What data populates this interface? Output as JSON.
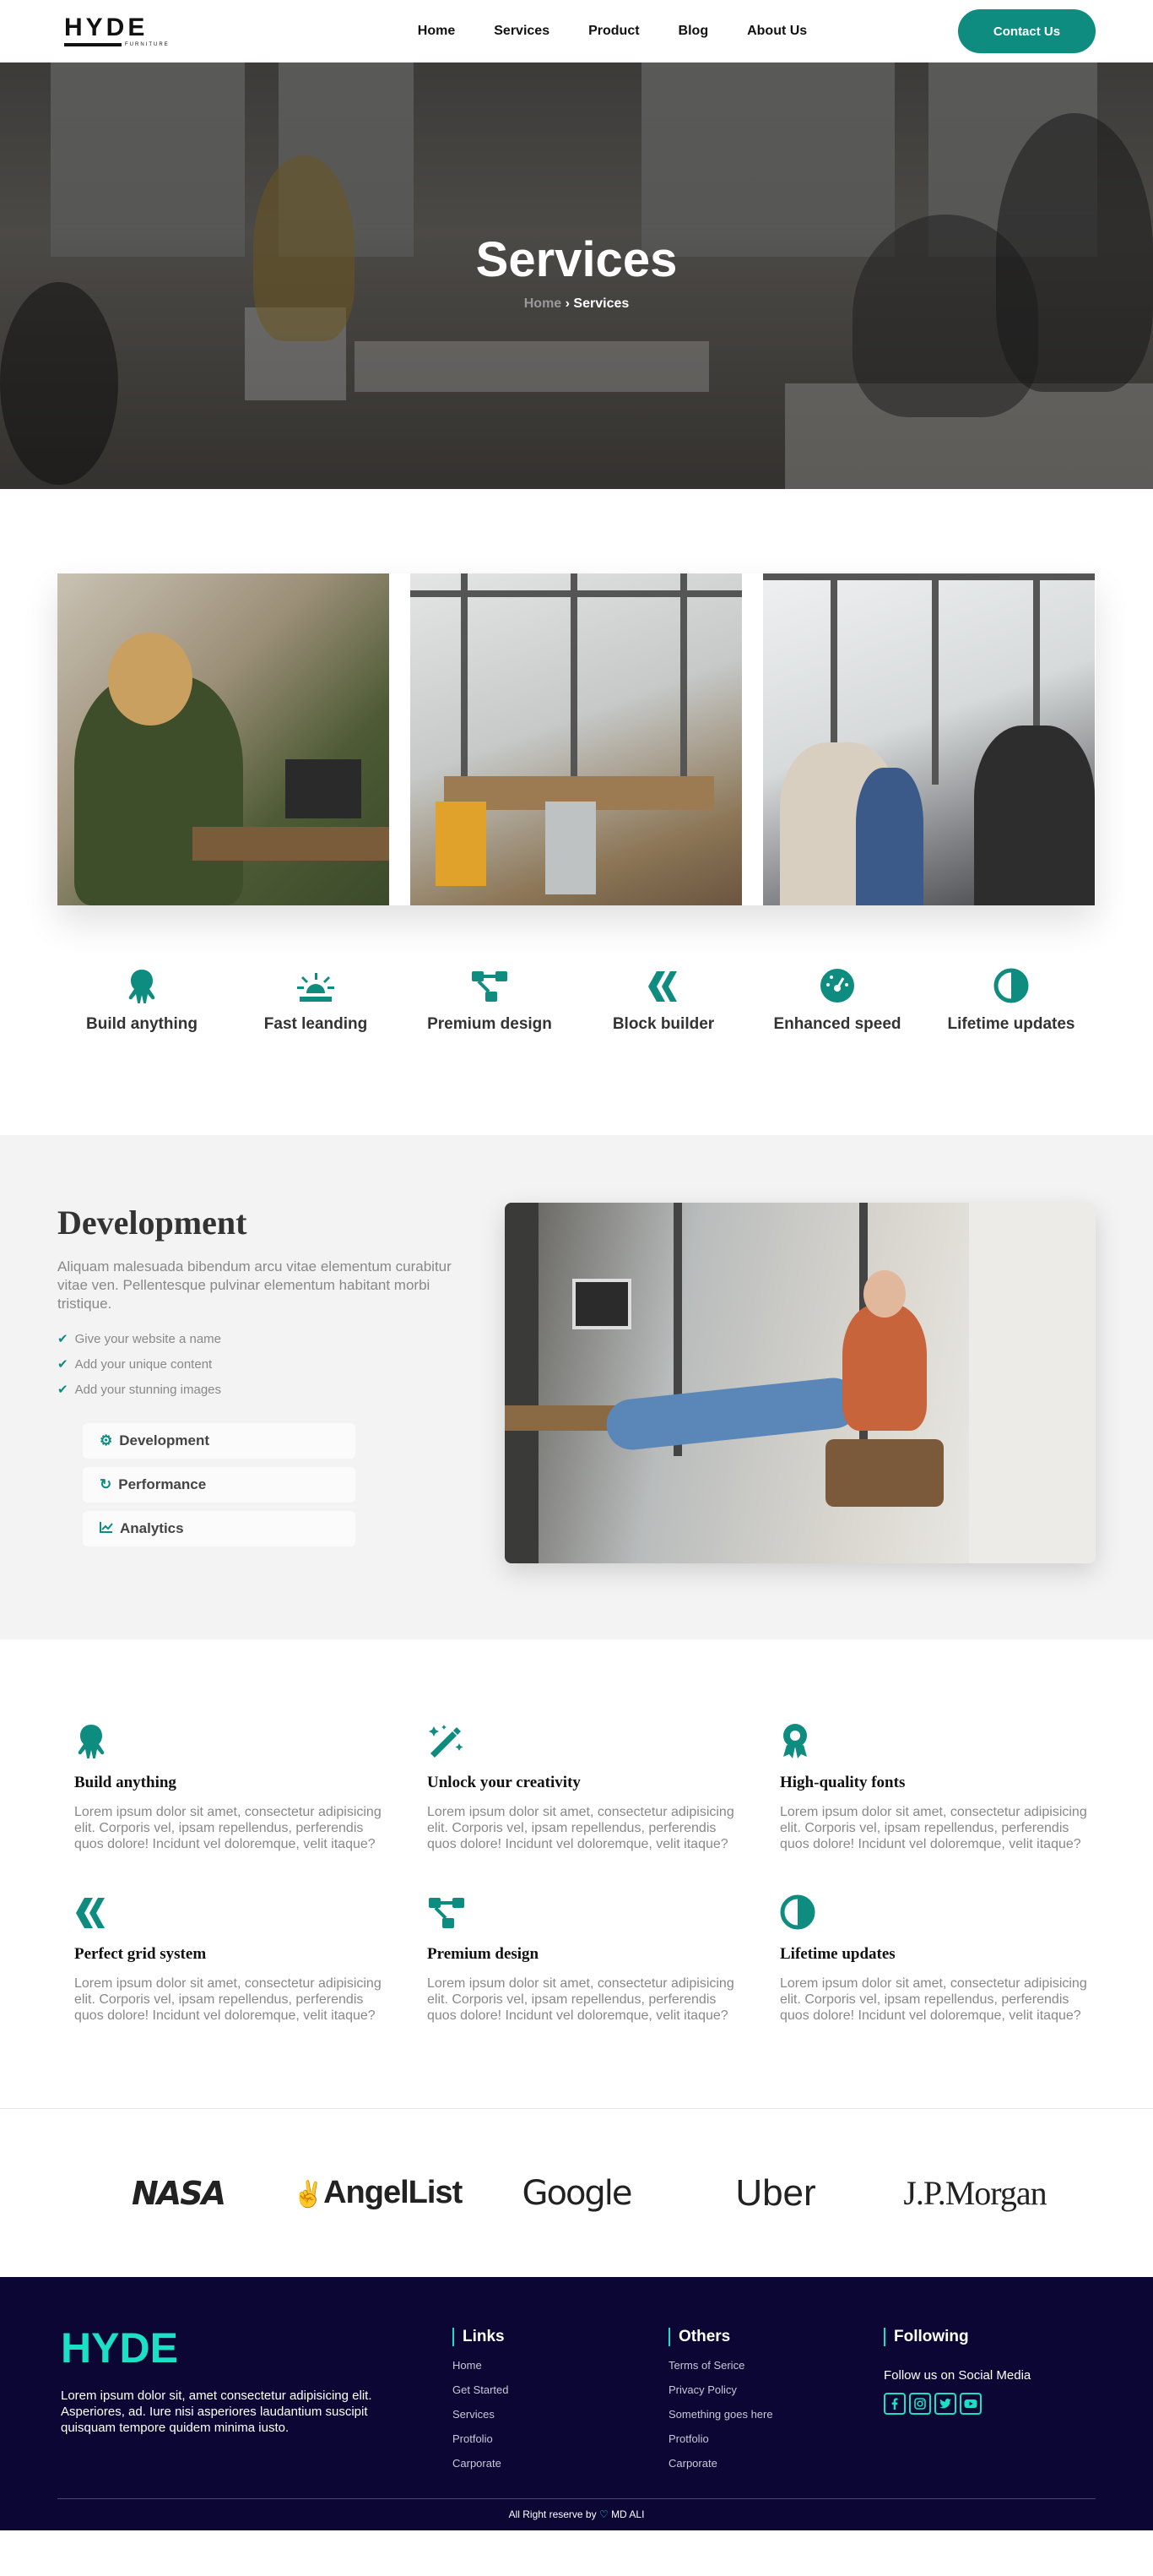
{
  "nav": {
    "logo": "HYDE",
    "logo_tag": "FURNITURE",
    "items": [
      {
        "label": "Home"
      },
      {
        "label": "Services"
      },
      {
        "label": "Product"
      },
      {
        "label": "Blog"
      },
      {
        "label": "About Us"
      }
    ],
    "contact_label": "Contact Us"
  },
  "hero": {
    "title": "Services",
    "crumb_home": "Home",
    "crumb_current": "Services"
  },
  "features": [
    {
      "label": "Build anything",
      "icon": "octopus-icon"
    },
    {
      "label": "Fast leanding",
      "icon": "alarm-light-icon"
    },
    {
      "label": "Premium design",
      "icon": "nodes-icon"
    },
    {
      "label": "Block builder",
      "icon": "chevrons-icon"
    },
    {
      "label": "Enhanced speed",
      "icon": "speedometer-icon"
    },
    {
      "label": "Lifetime updates",
      "icon": "half-circle-icon"
    }
  ],
  "development": {
    "title": "Development",
    "desc": "Aliquam malesuada bibendum arcu vitae elementum curabitur vitae ven. Pellentesque pulvinar elementum habitant morbi tristique.",
    "checks": [
      "Give your website a name",
      "Add your unique content",
      "Add your stunning images"
    ],
    "tabs": [
      {
        "label": "Development",
        "icon": "gear-icon"
      },
      {
        "label": "Performance",
        "icon": "refresh-icon"
      },
      {
        "label": "Analytics",
        "icon": "chart-line-icon"
      }
    ]
  },
  "cards": [
    {
      "title": "Build anything",
      "text": "Lorem ipsum dolor sit amet, consectetur adipisicing elit. Corporis vel, ipsam repellendus, perferendis quos dolore! Incidunt vel doloremque, velit itaque?",
      "icon": "octopus-icon"
    },
    {
      "title": "Unlock your creativity",
      "text": "Lorem ipsum dolor sit amet, consectetur adipisicing elit. Corporis vel, ipsam repellendus, perferendis quos dolore! Incidunt vel doloremque, velit itaque?",
      "icon": "magic-wand-icon"
    },
    {
      "title": "High-quality fonts",
      "text": "Lorem ipsum dolor sit amet, consectetur adipisicing elit. Corporis vel, ipsam repellendus, perferendis quos dolore! Incidunt vel doloremque, velit itaque?",
      "icon": "award-icon"
    },
    {
      "title": "Perfect grid system",
      "text": "Lorem ipsum dolor sit amet, consectetur adipisicing elit. Corporis vel, ipsam repellendus, perferendis quos dolore! Incidunt vel doloremque, velit itaque?",
      "icon": "chevrons-icon"
    },
    {
      "title": "Premium design",
      "text": "Lorem ipsum dolor sit amet, consectetur adipisicing elit. Corporis vel, ipsam repellendus, perferendis quos dolore! Incidunt vel doloremque, velit itaque?",
      "icon": "nodes-icon"
    },
    {
      "title": "Lifetime updates",
      "text": "Lorem ipsum dolor sit amet, consectetur adipisicing elit. Corporis vel, ipsam repellendus, perferendis quos dolore! Incidunt vel doloremque, velit itaque?",
      "icon": "half-circle-icon"
    }
  ],
  "brands": [
    "NASA",
    "AngelList",
    "Google",
    "Uber",
    "J.P.Morgan"
  ],
  "footer": {
    "logo": "HYDE",
    "desc": "Lorem ipsum dolor sit, amet consectetur adipisicing elit. Asperiores, ad. Iure nisi asperiores laudantium suscipit quisquam tempore quidem minima iusto.",
    "links_title": "Links",
    "links": [
      "Home",
      "Get Started",
      "Services",
      "Protfolio",
      "Carporate"
    ],
    "others_title": "Others",
    "others": [
      "Terms of Serice",
      "Privacy Policy",
      "Something goes here",
      "Protfolio",
      "Carporate"
    ],
    "following_title": "Following",
    "follow_text": "Follow us on Social Media",
    "socials": [
      "facebook-icon",
      "instagram-icon",
      "twitter-icon",
      "youtube-icon"
    ],
    "copyright_prefix": "All Right reserve by",
    "copyright_name": "MD ALI"
  },
  "colors": {
    "accent": "#0e8c80",
    "footer_bg": "#0c0634",
    "footer_accent": "#1be0c6"
  }
}
